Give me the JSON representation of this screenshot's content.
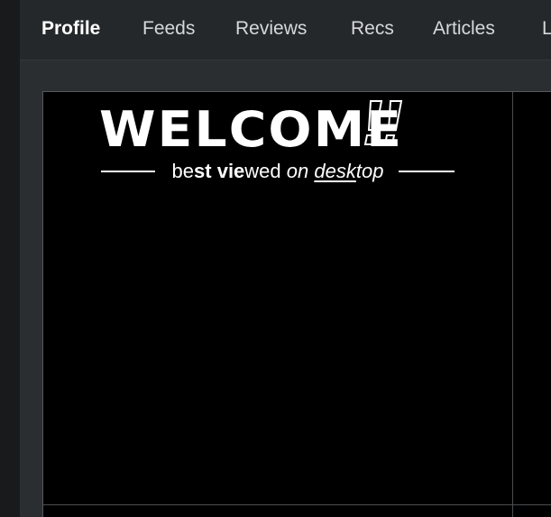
{
  "tabs": [
    {
      "label": "Profile",
      "active": true
    },
    {
      "label": "Feeds",
      "active": false
    },
    {
      "label": "Reviews",
      "active": false
    },
    {
      "label": "Recs",
      "active": false
    },
    {
      "label": "Articles",
      "active": false
    },
    {
      "label": "L",
      "active": false
    }
  ],
  "banner": {
    "welcome": "WELCOME",
    "exclaim_icon": "double-exclamation-outline-icon",
    "tagline_parts": {
      "p1": "be",
      "p2": "st ",
      "p3": "vie",
      "p4": "wed ",
      "p5": "on ",
      "p6": "desk",
      "p7": "top"
    }
  },
  "colors": {
    "accent": "#1e88c9",
    "banner_bg": "#000000",
    "tab_bg": "#25282b"
  }
}
